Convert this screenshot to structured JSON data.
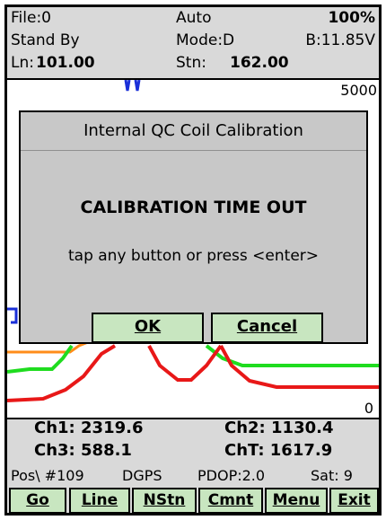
{
  "header": {
    "file": "File:0",
    "auto": "Auto",
    "battery_pct": "100%",
    "standby": "Stand By",
    "mode": "Mode:D",
    "battery_volt": "B:11.85V",
    "line_label": "Ln:",
    "line_value": "101.00",
    "station_label": "Stn:",
    "station_value": "162.00"
  },
  "plot": {
    "scale_top": "5000",
    "scale_bottom": "0",
    "colors": {
      "blue": "#1a2fd8",
      "orange": "#ff8c1a",
      "green": "#1fdc1f",
      "red": "#e81818"
    }
  },
  "dialog": {
    "title": "Internal QC Coil Calibration",
    "message": "CALIBRATION TIME OUT",
    "hint": "tap any button or press <enter>",
    "ok_label": "OK",
    "cancel_label": "Cancel"
  },
  "readouts": {
    "ch1": "Ch1:  2319.6",
    "ch2": "Ch2:  1130.4",
    "ch3": "Ch3:   588.1",
    "cht": "ChT:  1617.9"
  },
  "status": {
    "pos": "Pos\\ #109",
    "dgps": "DGPS",
    "pdop": "PDOP:2.0",
    "sat": "Sat: 9"
  },
  "toolbar": {
    "go": "Go",
    "line": "Line",
    "nstn": "NStn",
    "cmnt": "Cmnt",
    "menu": "Menu",
    "exit": "Exit"
  }
}
